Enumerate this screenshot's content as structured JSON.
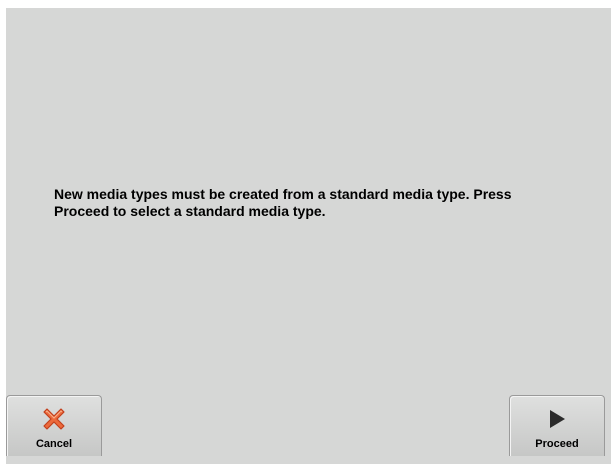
{
  "dialog": {
    "message": "New media types must be created from a standard media type.  Press\nProceed to select a standard media type."
  },
  "buttons": {
    "cancel": {
      "label": "Cancel",
      "icon": "close-x-icon",
      "icon_color": "#e8502a"
    },
    "proceed": {
      "label": "Proceed",
      "icon": "play-triangle-icon",
      "icon_color": "#2b2b2b"
    }
  }
}
